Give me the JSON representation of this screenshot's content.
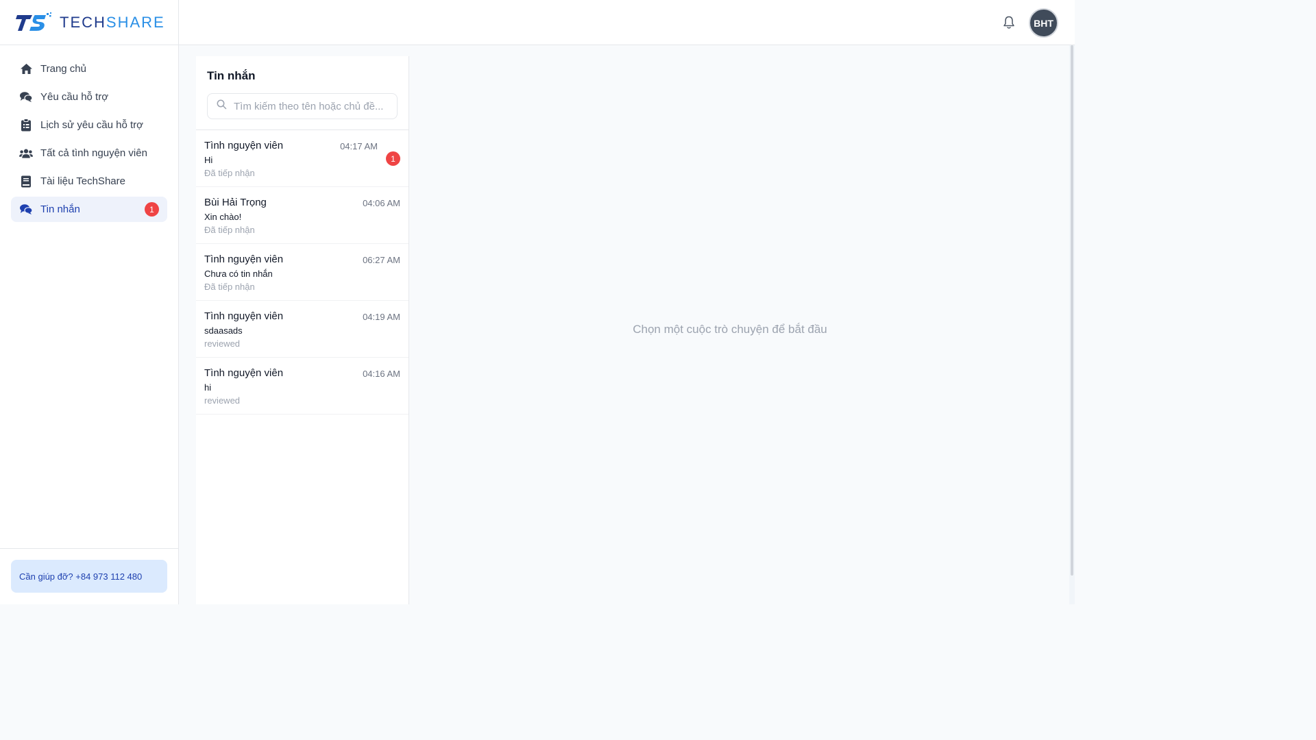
{
  "brand": {
    "name_part1": "TECH",
    "name_part2": "SHARE",
    "logo_letters": "TS"
  },
  "sidebar": {
    "items": [
      {
        "label": "Trang chủ",
        "icon": "home-icon"
      },
      {
        "label": "Yêu cầu hỗ trợ",
        "icon": "chat-icon"
      },
      {
        "label": "Lịch sử yêu cầu hỗ trợ",
        "icon": "clipboard-icon"
      },
      {
        "label": "Tất cả tình nguyện viên",
        "icon": "users-icon"
      },
      {
        "label": "Tài liệu TechShare",
        "icon": "book-icon"
      },
      {
        "label": "Tin nhắn",
        "icon": "messages-icon",
        "badge": "1",
        "active": true
      }
    ],
    "help_text": "Cần giúp đỡ? +84 973 112 480"
  },
  "header": {
    "avatar_initials": "BHT"
  },
  "conversations": {
    "title": "Tin nhắn",
    "search_placeholder": "Tìm kiếm theo tên hoặc chủ đề...",
    "items": [
      {
        "name": "Tình nguyện viên",
        "time": "04:17 AM",
        "message": "Hi",
        "status": "Đã tiếp nhận",
        "badge": "1"
      },
      {
        "name": "Bùi Hải Trọng",
        "time": "04:06 AM",
        "message": "Xin chào!",
        "status": "Đã tiếp nhận"
      },
      {
        "name": "Tình nguyện viên",
        "time": "06:27 AM",
        "message": "Chưa có tin nhắn",
        "status": "Đã tiếp nhận"
      },
      {
        "name": "Tình nguyện viên",
        "time": "04:19 AM",
        "message": "sdaasads",
        "status": "reviewed"
      },
      {
        "name": "Tình nguyện viên",
        "time": "04:16 AM",
        "message": "hi",
        "status": "reviewed"
      }
    ]
  },
  "chat": {
    "empty_text": "Chọn một cuộc trò chuyện để bắt đầu"
  },
  "colors": {
    "accent": "#1e40af",
    "badge": "#ef4444",
    "active_bg": "#eef2fb",
    "help_bg": "#dbeafe"
  }
}
